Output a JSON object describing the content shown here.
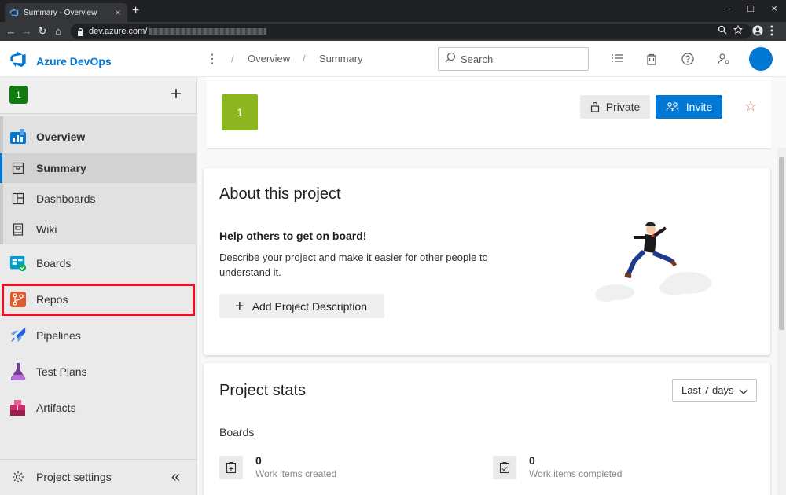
{
  "browser": {
    "tab_title": "Summary - Overview",
    "url_visible": "dev.azure.com/",
    "new_tab": "+",
    "tab_close": "×",
    "win_minimize": "–",
    "win_maximize": "□",
    "win_close": "×",
    "nav_back": "←",
    "nav_forward": "→",
    "nav_reload": "↻",
    "nav_home": "⌂"
  },
  "header": {
    "brand": "Azure DevOps",
    "more": "⋮",
    "breadcrumb": [
      "Overview",
      "Summary"
    ],
    "breadcrumb_sep": "/",
    "search_placeholder": "Search"
  },
  "sidebar": {
    "project_badge": "1",
    "add": "+",
    "items": [
      {
        "label": "Overview",
        "icon": "overview-icon"
      },
      {
        "label": "Summary",
        "icon": "summary-icon",
        "selected": true
      },
      {
        "label": "Dashboards",
        "icon": "dashboards-icon"
      },
      {
        "label": "Wiki",
        "icon": "wiki-icon"
      },
      {
        "label": "Boards",
        "icon": "boards-icon"
      },
      {
        "label": "Repos",
        "icon": "repos-icon",
        "highlighted": true
      },
      {
        "label": "Pipelines",
        "icon": "pipelines-icon"
      },
      {
        "label": "Test Plans",
        "icon": "test-plans-icon"
      },
      {
        "label": "Artifacts",
        "icon": "artifacts-icon"
      }
    ],
    "settings_label": "Project settings",
    "collapse": "«"
  },
  "project": {
    "badge": "1",
    "private_label": "Private",
    "invite_label": "Invite",
    "favorite": "☆"
  },
  "about": {
    "title": "About this project",
    "subtitle": "Help others to get on board!",
    "description": "Describe your project and make it easier for other people to understand it.",
    "add_description_label": "Add Project Description"
  },
  "stats": {
    "title": "Project stats",
    "range": "Last 7 days",
    "section": "Boards",
    "items": [
      {
        "value": "0",
        "label": "Work items created"
      },
      {
        "value": "0",
        "label": "Work items completed"
      }
    ]
  },
  "colors": {
    "accent": "#0078d4",
    "project_badge": "#107c10",
    "project_tile": "#8cb51f",
    "highlight": "#e81123"
  }
}
